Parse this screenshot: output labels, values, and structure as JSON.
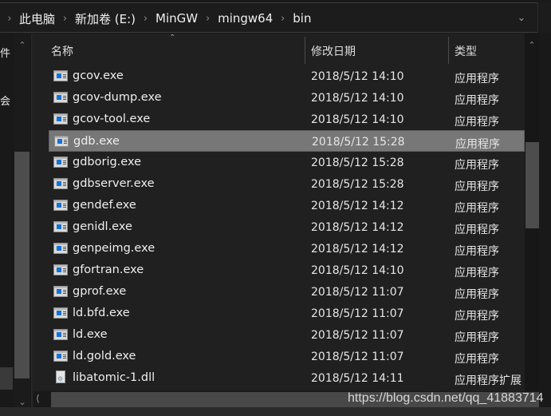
{
  "address_bar": {
    "breadcrumbs": [
      "此电脑",
      "新加卷 (E:)",
      "MinGW",
      "mingw64",
      "bin"
    ],
    "dropdown_icon": "chevron-down-icon"
  },
  "nav_pane": {
    "items": [
      "件",
      "会"
    ]
  },
  "columns": {
    "name": "名称",
    "date": "修改日期",
    "type": "类型"
  },
  "files": [
    {
      "name": "gcov.exe",
      "date": "2018/5/12 14:10",
      "type": "应用程序",
      "icon": "exe"
    },
    {
      "name": "gcov-dump.exe",
      "date": "2018/5/12 14:10",
      "type": "应用程序",
      "icon": "exe"
    },
    {
      "name": "gcov-tool.exe",
      "date": "2018/5/12 14:10",
      "type": "应用程序",
      "icon": "exe"
    },
    {
      "name": "gdb.exe",
      "date": "2018/5/12 15:28",
      "type": "应用程序",
      "icon": "exe",
      "selected": true
    },
    {
      "name": "gdborig.exe",
      "date": "2018/5/12 15:28",
      "type": "应用程序",
      "icon": "exe"
    },
    {
      "name": "gdbserver.exe",
      "date": "2018/5/12 15:28",
      "type": "应用程序",
      "icon": "exe"
    },
    {
      "name": "gendef.exe",
      "date": "2018/5/12 14:12",
      "type": "应用程序",
      "icon": "exe"
    },
    {
      "name": "genidl.exe",
      "date": "2018/5/12 14:12",
      "type": "应用程序",
      "icon": "exe"
    },
    {
      "name": "genpeimg.exe",
      "date": "2018/5/12 14:12",
      "type": "应用程序",
      "icon": "exe"
    },
    {
      "name": "gfortran.exe",
      "date": "2018/5/12 14:10",
      "type": "应用程序",
      "icon": "exe"
    },
    {
      "name": "gprof.exe",
      "date": "2018/5/12 11:07",
      "type": "应用程序",
      "icon": "exe"
    },
    {
      "name": "ld.bfd.exe",
      "date": "2018/5/12 11:07",
      "type": "应用程序",
      "icon": "exe"
    },
    {
      "name": "ld.exe",
      "date": "2018/5/12 11:07",
      "type": "应用程序",
      "icon": "exe"
    },
    {
      "name": "ld.gold.exe",
      "date": "2018/5/12 11:07",
      "type": "应用程序",
      "icon": "exe"
    },
    {
      "name": "libatomic-1.dll",
      "date": "2018/5/12 14:11",
      "type": "应用程序扩展",
      "icon": "dll"
    }
  ],
  "watermark": "https://blog.csdn.net/qq_41883714"
}
